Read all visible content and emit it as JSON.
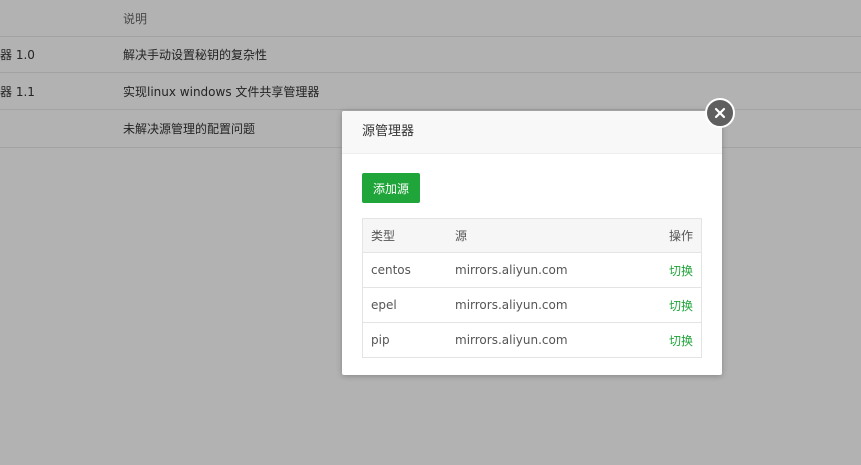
{
  "background": {
    "header": {
      "col2": "说明"
    },
    "rows": [
      {
        "col1": "器 1.0",
        "col2": "解决手动设置秘钥的复杂性"
      },
      {
        "col1": "器 1.1",
        "col2": "实现linux windows 文件共享管理器"
      },
      {
        "col1": "",
        "col2": "未解决源管理的配置问题"
      }
    ]
  },
  "dialog": {
    "title": "源管理器",
    "add_button": "添加源",
    "close_icon": "close-icon",
    "table": {
      "headers": {
        "type": "类型",
        "source": "源",
        "action": "操作"
      },
      "rows": [
        {
          "type": "centos",
          "source": "mirrors.aliyun.com",
          "action": "切换"
        },
        {
          "type": "epel",
          "source": "mirrors.aliyun.com",
          "action": "切换"
        },
        {
          "type": "pip",
          "source": "mirrors.aliyun.com",
          "action": "切换"
        }
      ]
    }
  },
  "colors": {
    "accent": "#20a53a",
    "overlay": "#000000",
    "close_bg": "#5f5f5f"
  }
}
